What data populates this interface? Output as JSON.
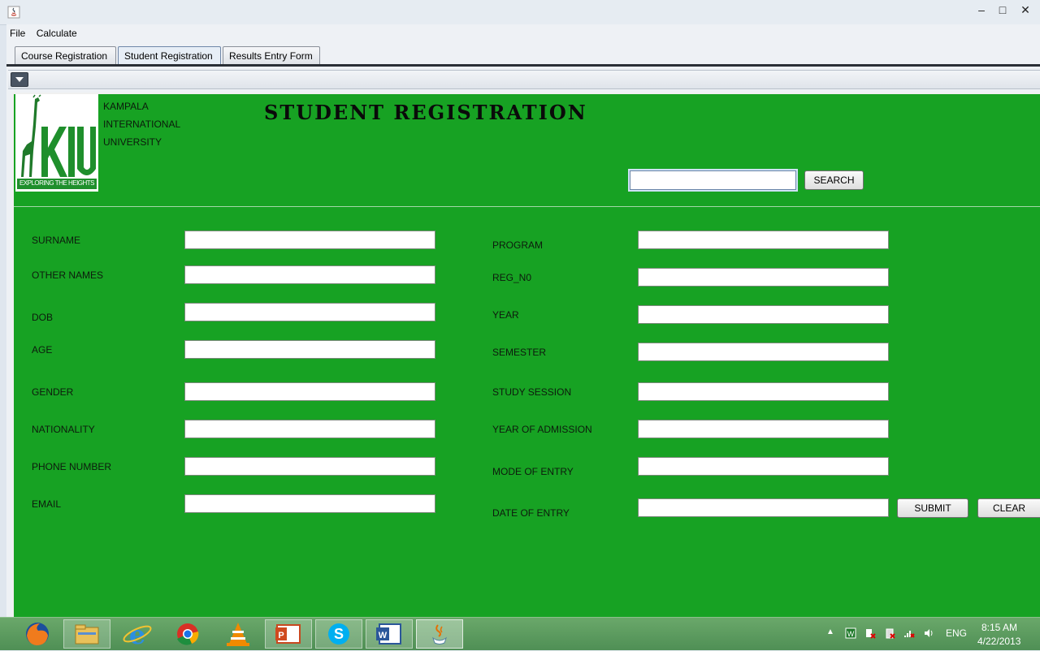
{
  "menu": {
    "file": "File",
    "calculate": "Calculate"
  },
  "tabs": [
    {
      "label": "Course Registration"
    },
    {
      "label": "Student Registration"
    },
    {
      "label": "Results Entry Form"
    }
  ],
  "header": {
    "logo_text": "EXPLORING THE HEIGHTS",
    "logo_letters": "KIU",
    "university_lines": [
      "KAMPALA",
      "INTERNATIONAL",
      "UNIVERSITY"
    ],
    "title": "STUDENT REGISTRATION",
    "search_value": "",
    "search_button": "SEARCH"
  },
  "form_left": [
    {
      "label": "SURNAME",
      "value": ""
    },
    {
      "label": "OTHER NAMES",
      "value": ""
    },
    {
      "label": "DOB",
      "value": ""
    },
    {
      "label": "AGE",
      "value": ""
    },
    {
      "label": "GENDER",
      "value": ""
    },
    {
      "label": "NATIONALITY",
      "value": ""
    },
    {
      "label": "PHONE NUMBER",
      "value": ""
    },
    {
      "label": "EMAIL",
      "value": ""
    }
  ],
  "form_right": [
    {
      "label": "PROGRAM",
      "value": ""
    },
    {
      "label": "REG_N0",
      "value": ""
    },
    {
      "label": "YEAR",
      "value": ""
    },
    {
      "label": "SEMESTER",
      "value": ""
    },
    {
      "label": "STUDY SESSION",
      "value": ""
    },
    {
      "label": "YEAR OF ADMISSION",
      "value": ""
    },
    {
      "label": "MODE OF ENTRY",
      "value": ""
    },
    {
      "label": "DATE OF ENTRY",
      "value": ""
    }
  ],
  "actions": {
    "submit": "SUBMIT",
    "clear": "CLEAR"
  },
  "taskbar": {
    "apps": [
      "firefox-icon",
      "file-explorer-icon",
      "internet-explorer-icon",
      "chrome-icon",
      "vlc-icon",
      "powerpoint-icon",
      "skype-icon",
      "word-icon",
      "java-icon"
    ],
    "language": "ENG",
    "time": "8:15 AM",
    "date": "4/22/2013"
  },
  "colors": {
    "panel_green": "#17a223",
    "taskbar_green": "#5a9a5e"
  }
}
